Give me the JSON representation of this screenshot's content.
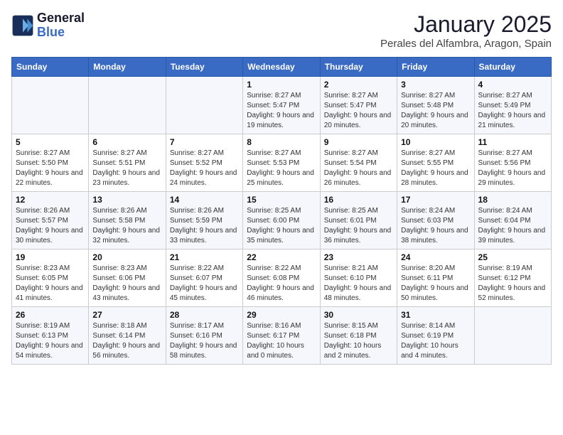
{
  "header": {
    "logo_line1": "General",
    "logo_line2": "Blue",
    "title": "January 2025",
    "subtitle": "Perales del Alfambra, Aragon, Spain"
  },
  "weekdays": [
    "Sunday",
    "Monday",
    "Tuesday",
    "Wednesday",
    "Thursday",
    "Friday",
    "Saturday"
  ],
  "weeks": [
    [
      {
        "day": "",
        "info": ""
      },
      {
        "day": "",
        "info": ""
      },
      {
        "day": "",
        "info": ""
      },
      {
        "day": "1",
        "info": "Sunrise: 8:27 AM\nSunset: 5:47 PM\nDaylight: 9 hours and 19 minutes."
      },
      {
        "day": "2",
        "info": "Sunrise: 8:27 AM\nSunset: 5:47 PM\nDaylight: 9 hours and 20 minutes."
      },
      {
        "day": "3",
        "info": "Sunrise: 8:27 AM\nSunset: 5:48 PM\nDaylight: 9 hours and 20 minutes."
      },
      {
        "day": "4",
        "info": "Sunrise: 8:27 AM\nSunset: 5:49 PM\nDaylight: 9 hours and 21 minutes."
      }
    ],
    [
      {
        "day": "5",
        "info": "Sunrise: 8:27 AM\nSunset: 5:50 PM\nDaylight: 9 hours and 22 minutes."
      },
      {
        "day": "6",
        "info": "Sunrise: 8:27 AM\nSunset: 5:51 PM\nDaylight: 9 hours and 23 minutes."
      },
      {
        "day": "7",
        "info": "Sunrise: 8:27 AM\nSunset: 5:52 PM\nDaylight: 9 hours and 24 minutes."
      },
      {
        "day": "8",
        "info": "Sunrise: 8:27 AM\nSunset: 5:53 PM\nDaylight: 9 hours and 25 minutes."
      },
      {
        "day": "9",
        "info": "Sunrise: 8:27 AM\nSunset: 5:54 PM\nDaylight: 9 hours and 26 minutes."
      },
      {
        "day": "10",
        "info": "Sunrise: 8:27 AM\nSunset: 5:55 PM\nDaylight: 9 hours and 28 minutes."
      },
      {
        "day": "11",
        "info": "Sunrise: 8:27 AM\nSunset: 5:56 PM\nDaylight: 9 hours and 29 minutes."
      }
    ],
    [
      {
        "day": "12",
        "info": "Sunrise: 8:26 AM\nSunset: 5:57 PM\nDaylight: 9 hours and 30 minutes."
      },
      {
        "day": "13",
        "info": "Sunrise: 8:26 AM\nSunset: 5:58 PM\nDaylight: 9 hours and 32 minutes."
      },
      {
        "day": "14",
        "info": "Sunrise: 8:26 AM\nSunset: 5:59 PM\nDaylight: 9 hours and 33 minutes."
      },
      {
        "day": "15",
        "info": "Sunrise: 8:25 AM\nSunset: 6:00 PM\nDaylight: 9 hours and 35 minutes."
      },
      {
        "day": "16",
        "info": "Sunrise: 8:25 AM\nSunset: 6:01 PM\nDaylight: 9 hours and 36 minutes."
      },
      {
        "day": "17",
        "info": "Sunrise: 8:24 AM\nSunset: 6:03 PM\nDaylight: 9 hours and 38 minutes."
      },
      {
        "day": "18",
        "info": "Sunrise: 8:24 AM\nSunset: 6:04 PM\nDaylight: 9 hours and 39 minutes."
      }
    ],
    [
      {
        "day": "19",
        "info": "Sunrise: 8:23 AM\nSunset: 6:05 PM\nDaylight: 9 hours and 41 minutes."
      },
      {
        "day": "20",
        "info": "Sunrise: 8:23 AM\nSunset: 6:06 PM\nDaylight: 9 hours and 43 minutes."
      },
      {
        "day": "21",
        "info": "Sunrise: 8:22 AM\nSunset: 6:07 PM\nDaylight: 9 hours and 45 minutes."
      },
      {
        "day": "22",
        "info": "Sunrise: 8:22 AM\nSunset: 6:08 PM\nDaylight: 9 hours and 46 minutes."
      },
      {
        "day": "23",
        "info": "Sunrise: 8:21 AM\nSunset: 6:10 PM\nDaylight: 9 hours and 48 minutes."
      },
      {
        "day": "24",
        "info": "Sunrise: 8:20 AM\nSunset: 6:11 PM\nDaylight: 9 hours and 50 minutes."
      },
      {
        "day": "25",
        "info": "Sunrise: 8:19 AM\nSunset: 6:12 PM\nDaylight: 9 hours and 52 minutes."
      }
    ],
    [
      {
        "day": "26",
        "info": "Sunrise: 8:19 AM\nSunset: 6:13 PM\nDaylight: 9 hours and 54 minutes."
      },
      {
        "day": "27",
        "info": "Sunrise: 8:18 AM\nSunset: 6:14 PM\nDaylight: 9 hours and 56 minutes."
      },
      {
        "day": "28",
        "info": "Sunrise: 8:17 AM\nSunset: 6:16 PM\nDaylight: 9 hours and 58 minutes."
      },
      {
        "day": "29",
        "info": "Sunrise: 8:16 AM\nSunset: 6:17 PM\nDaylight: 10 hours and 0 minutes."
      },
      {
        "day": "30",
        "info": "Sunrise: 8:15 AM\nSunset: 6:18 PM\nDaylight: 10 hours and 2 minutes."
      },
      {
        "day": "31",
        "info": "Sunrise: 8:14 AM\nSunset: 6:19 PM\nDaylight: 10 hours and 4 minutes."
      },
      {
        "day": "",
        "info": ""
      }
    ]
  ]
}
